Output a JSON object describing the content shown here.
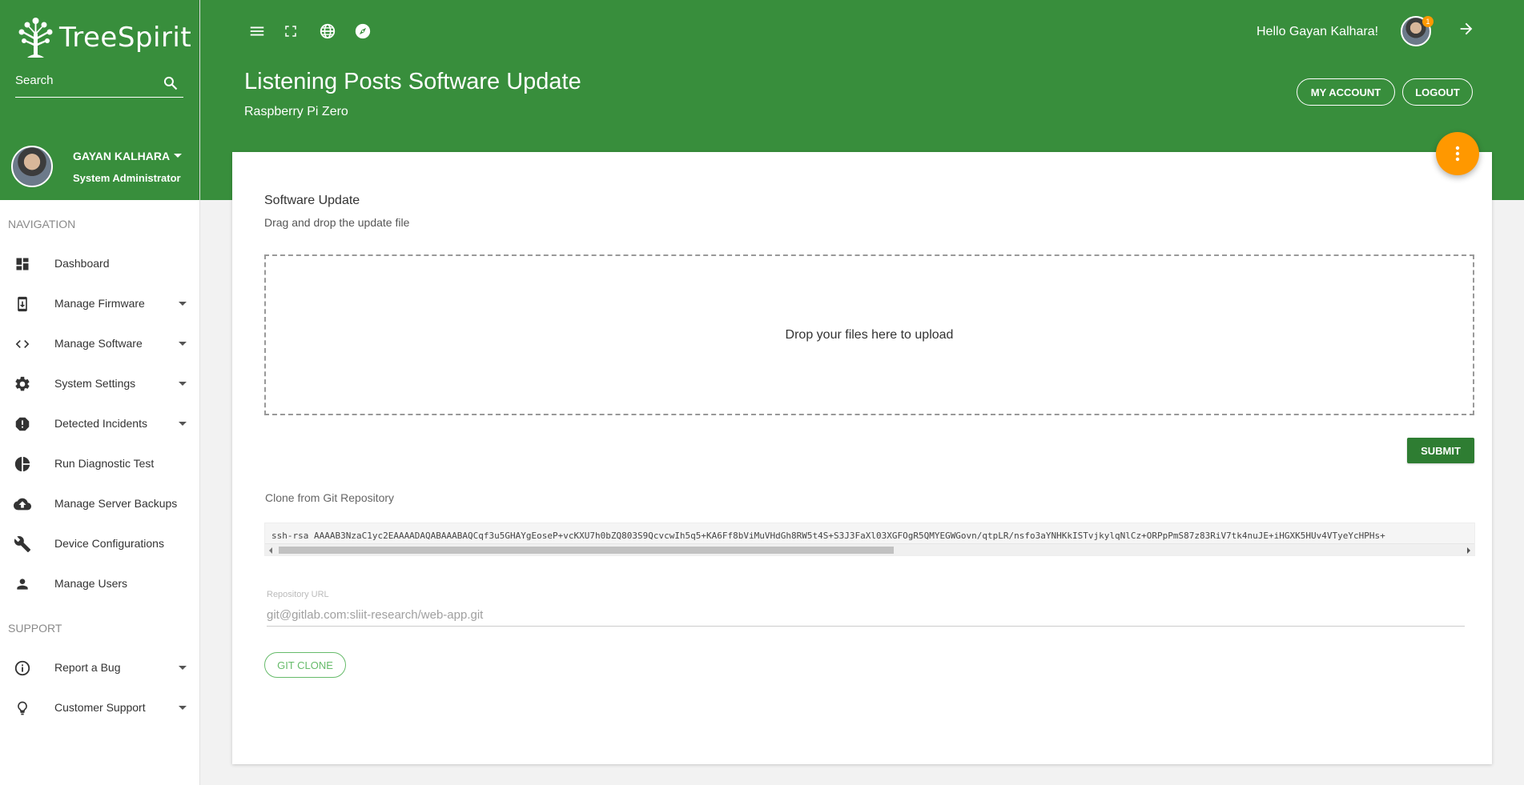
{
  "brand": {
    "name": "TreeSpirit"
  },
  "sidebar": {
    "search_placeholder": "Search",
    "user": {
      "name": "GAYAN KALHARA",
      "role": "System Administrator"
    },
    "sections": [
      {
        "title": "NAVIGATION"
      },
      {
        "title": "SUPPORT"
      }
    ],
    "items": [
      {
        "label": "Dashboard",
        "icon": "dashboard-icon",
        "has_caret": false
      },
      {
        "label": "Manage Firmware",
        "icon": "firmware-download-icon",
        "has_caret": true
      },
      {
        "label": "Manage Software",
        "icon": "code-icon",
        "has_caret": true
      },
      {
        "label": "System Settings",
        "icon": "gear-icon",
        "has_caret": true
      },
      {
        "label": "Detected Incidents",
        "icon": "alert-icon",
        "has_caret": true
      },
      {
        "label": "Run Diagnostic Test",
        "icon": "pie-chart-icon",
        "has_caret": false
      },
      {
        "label": "Manage Server Backups",
        "icon": "cloud-upload-icon",
        "has_caret": false
      },
      {
        "label": "Device Configurations",
        "icon": "wrench-icon",
        "has_caret": false
      },
      {
        "label": "Manage Users",
        "icon": "person-icon",
        "has_caret": false
      },
      {
        "label": "Report a Bug",
        "icon": "info-icon",
        "has_caret": true
      },
      {
        "label": "Customer Support",
        "icon": "lightbulb-icon",
        "has_caret": true
      }
    ]
  },
  "header": {
    "icons": [
      "menu-icon",
      "fullscreen-icon",
      "globe-icon",
      "compass-icon"
    ],
    "greeting": "Hello Gayan Kalhara!",
    "notification_count": "1",
    "title": "Listening Posts Software Update",
    "subtitle": "Raspberry Pi Zero",
    "my_account_label": "MY ACCOUNT",
    "logout_label": "LOGOUT"
  },
  "card": {
    "section_title": "Software Update",
    "section_desc": "Drag and drop the update file",
    "dropzone_text": "Drop your files here to upload",
    "submit_label": "SUBMIT",
    "git_title": "Clone from Git Repository",
    "ssh_key": "ssh-rsa AAAAB3NzaC1yc2EAAAADAQABAAABAQCqf3u5GHAYgEoseP+vcKXU7h0bZQ803S9QcvcwIh5q5+KA6Ff8bViMuVHdGh8RW5t4S+S3J3FaXl03XGFOgR5QMYEGWGovn/qtpLR/nsfo3aYNHKkISTvjkylqNlCz+ORPpPmS87z83RiV7tk4nuJE+iHGXK5HUv4VTyeYcHPHs+",
    "repo_label": "Repository URL",
    "repo_placeholder": "git@gitlab.com:sliit-research/web-app.git",
    "git_clone_label": "GIT CLONE"
  },
  "colors": {
    "primary": "#388e3c",
    "primary_dark": "#2e7d32",
    "accent": "#ff9800",
    "light_green": "#66bb6a"
  }
}
